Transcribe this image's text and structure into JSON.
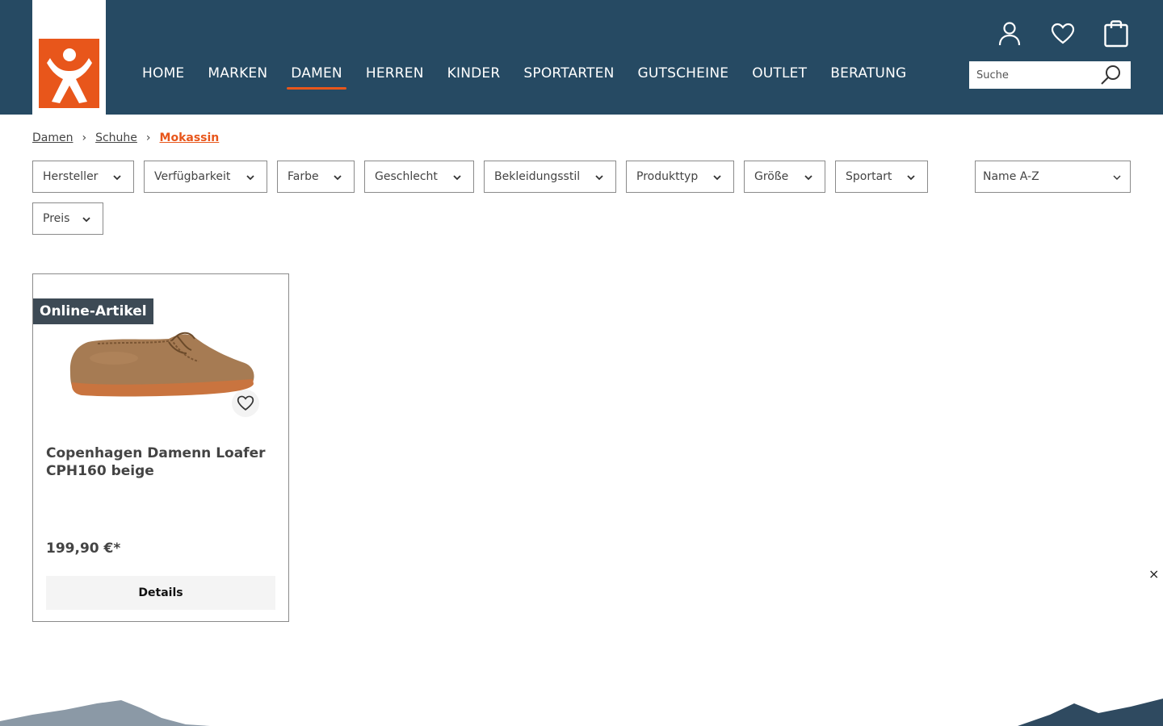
{
  "brand": {
    "logo_color": "#e8561b",
    "header_bg": "#264a63"
  },
  "nav": {
    "items": [
      {
        "label": "HOME"
      },
      {
        "label": "MARKEN"
      },
      {
        "label": "DAMEN"
      },
      {
        "label": "HERREN"
      },
      {
        "label": "KINDER"
      },
      {
        "label": "SPORTARTEN"
      },
      {
        "label": "GUTSCHEINE"
      },
      {
        "label": "OUTLET"
      },
      {
        "label": "BERATUNG"
      }
    ],
    "active": "DAMEN"
  },
  "header_icons": [
    "user-icon",
    "heart-icon",
    "shopping-bag-icon"
  ],
  "search": {
    "placeholder": "Suche",
    "icon": "search-icon"
  },
  "breadcrumb": {
    "items": [
      "Damen",
      "Schuhe"
    ],
    "current": "Mokassin"
  },
  "filters": {
    "hersteller": "Hersteller",
    "verfuegbarkeit": "Verfügbarkeit",
    "farbe": "Farbe",
    "geschlecht": "Geschlecht",
    "bekleidungsstil": "Bekleidungsstil",
    "produkttyp": "Produkttyp",
    "groesse": "Größe",
    "sportart": "Sportart",
    "preis": "Preis"
  },
  "sort": {
    "selected": "Name A-Z"
  },
  "product": {
    "badge": "Online-Artikel",
    "title": "Copenhagen Damenn Loafer CPH160 beige",
    "price": "199,90 €*",
    "details_label": "Details"
  },
  "overlay": {
    "close_label": "×"
  }
}
